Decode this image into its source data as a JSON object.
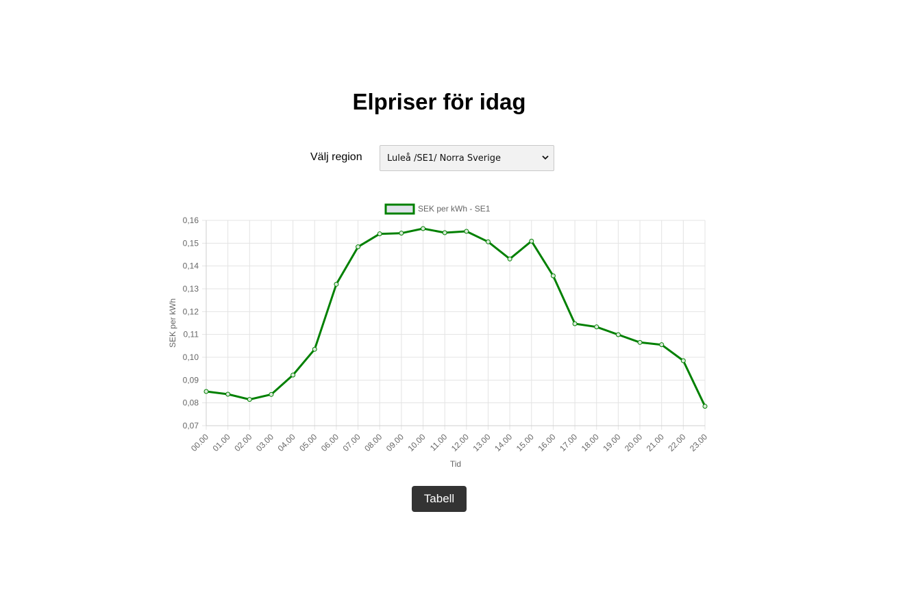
{
  "page": {
    "title": "Elpriser för idag"
  },
  "region": {
    "label": "Välj region",
    "selected": "Luleå /SE1/ Norra Sverige"
  },
  "actions": {
    "table_button": "Tabell"
  },
  "colors": {
    "line": "#008000",
    "legend_fill": "#dfe3ea",
    "grid": "#e3e3e3",
    "button_bg": "#333333"
  },
  "chart_data": {
    "type": "line",
    "title": "",
    "xlabel": "Tid",
    "ylabel": "SEK per kWh",
    "x": [
      "00.00",
      "01.00",
      "02.00",
      "03.00",
      "04.00",
      "05.00",
      "06.00",
      "07.00",
      "08.00",
      "09.00",
      "10.00",
      "11.00",
      "12.00",
      "13.00",
      "14.00",
      "15.00",
      "16.00",
      "17.00",
      "18.00",
      "19.00",
      "20.00",
      "21.00",
      "22.00",
      "23.00"
    ],
    "ylim": [
      0.07,
      0.16
    ],
    "yticks": [
      "0,16",
      "0,15",
      "0,14",
      "0,13",
      "0,12",
      "0,11",
      "0,10",
      "0,09",
      "0,08",
      "0,07"
    ],
    "series": [
      {
        "name": "SEK per kWh - SE1",
        "values": [
          0.085,
          0.0838,
          0.0815,
          0.0837,
          0.0922,
          0.1035,
          0.132,
          0.1484,
          0.1541,
          0.1544,
          0.1564,
          0.1546,
          0.1552,
          0.1506,
          0.1431,
          0.1509,
          0.1357,
          0.1147,
          0.1133,
          0.1099,
          0.1065,
          0.1055,
          0.0985,
          0.0785
        ]
      }
    ],
    "grid": true,
    "legend_position": "top-center"
  }
}
